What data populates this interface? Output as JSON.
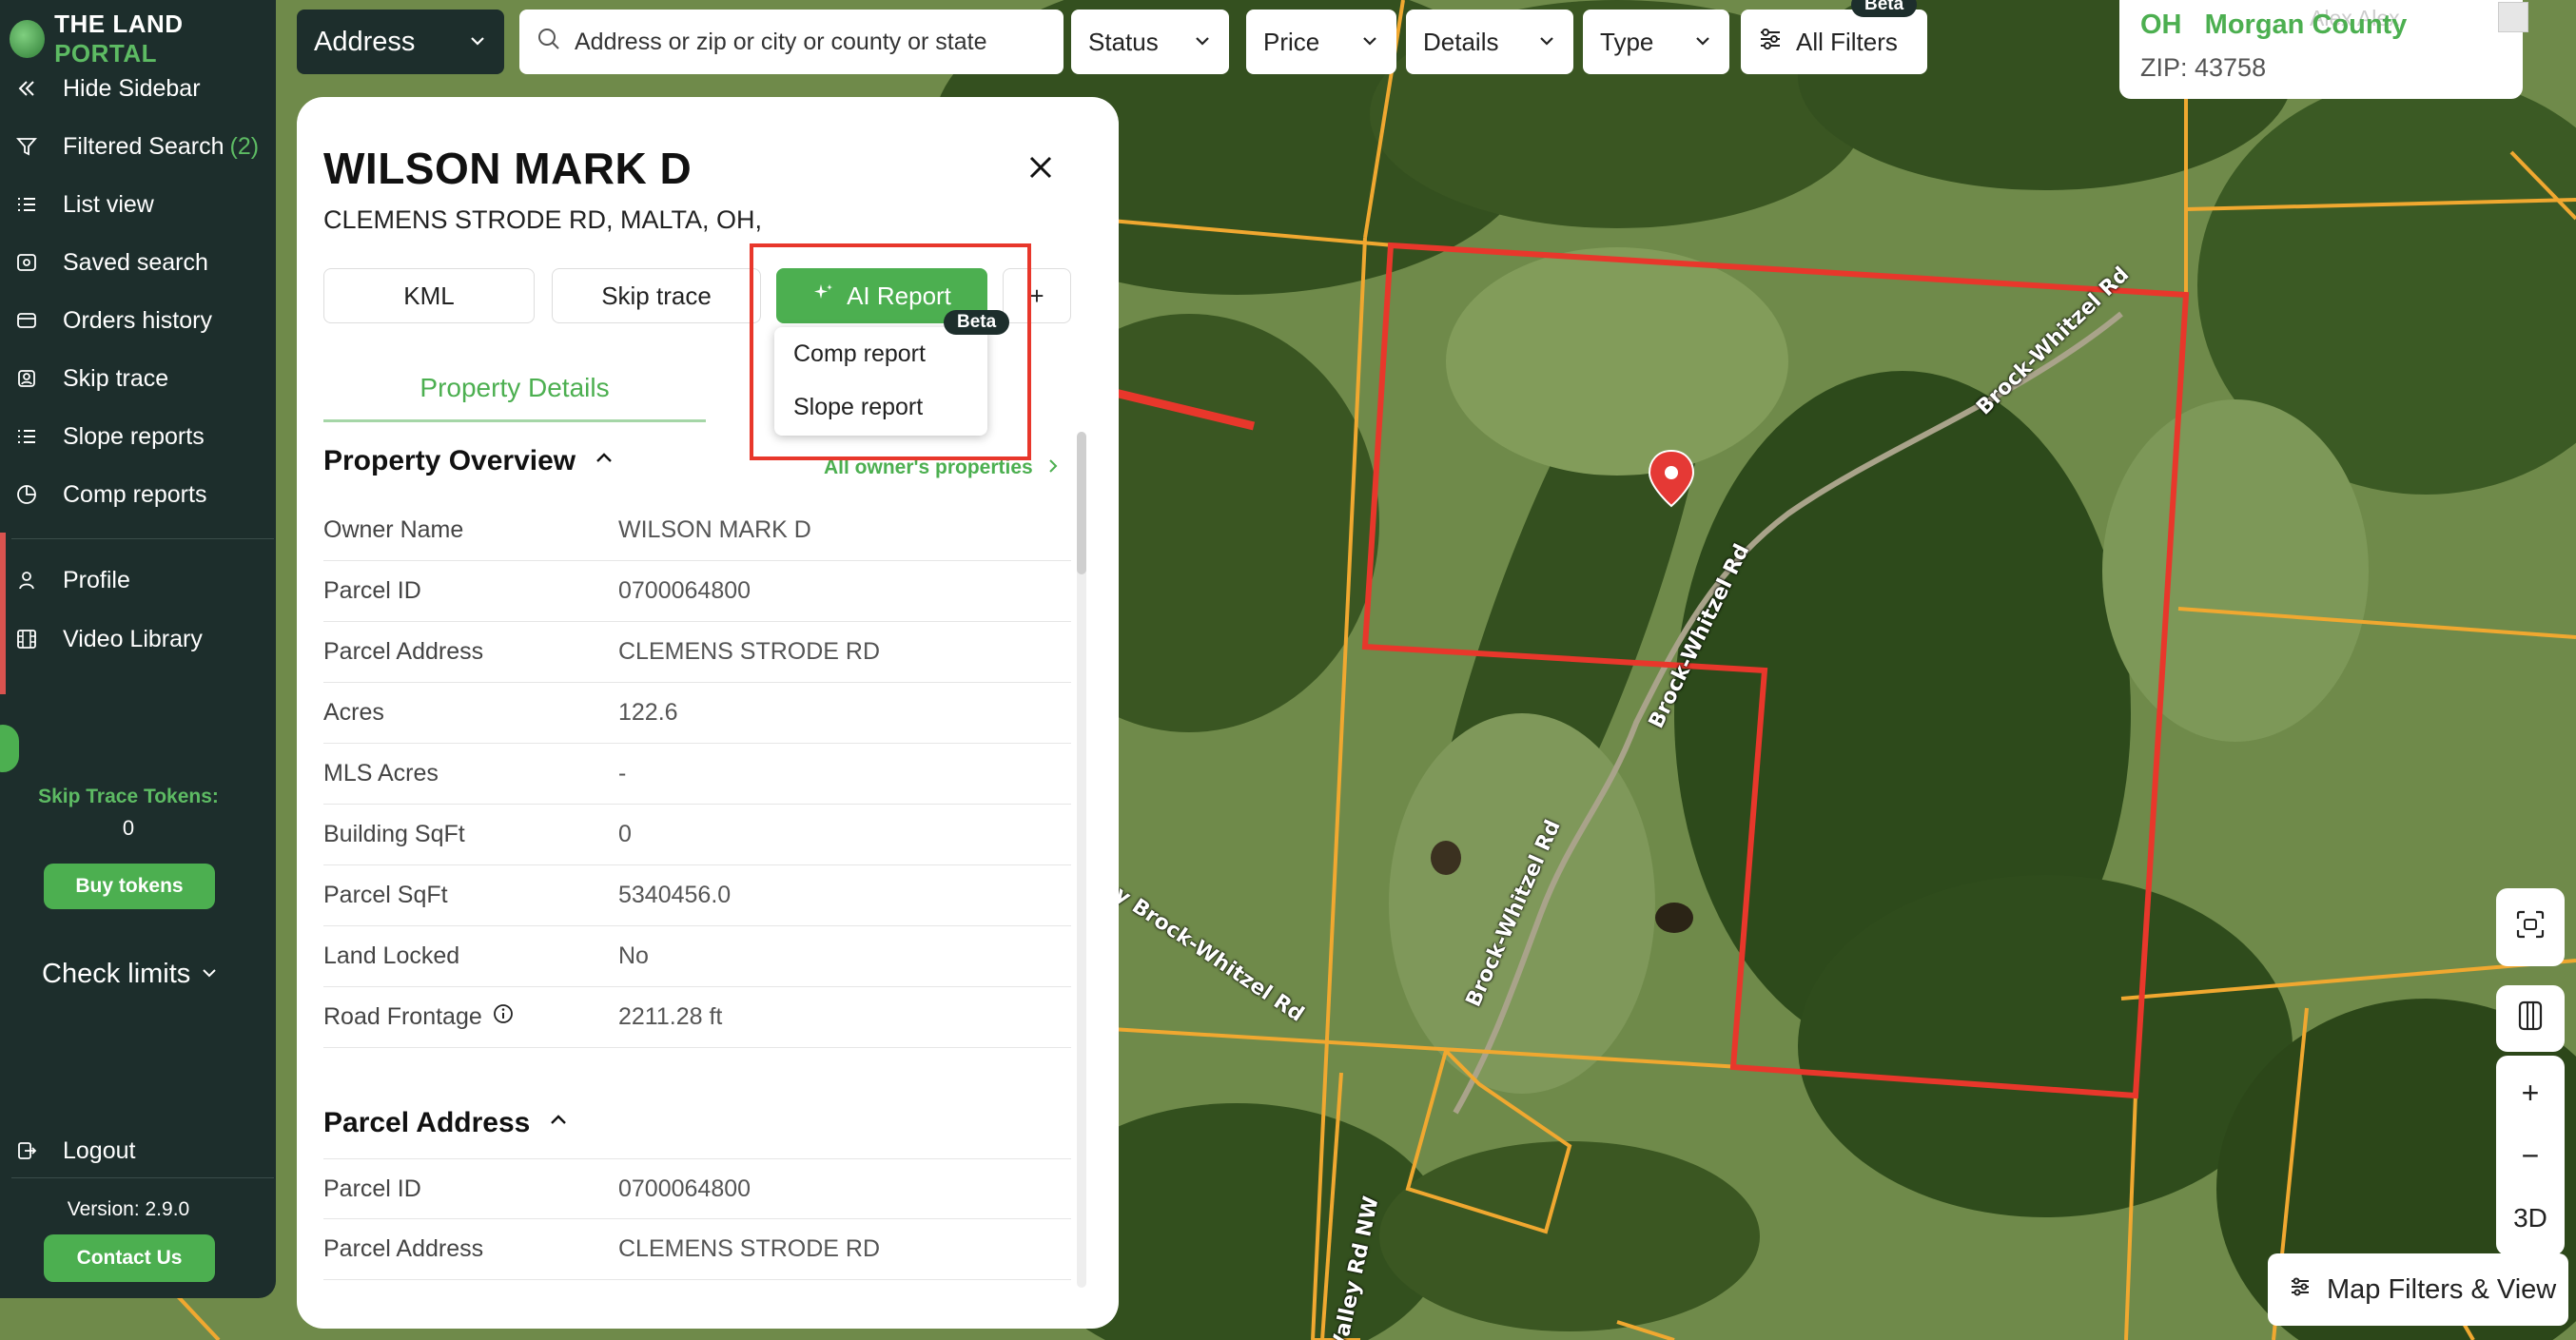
{
  "brand": {
    "name_part1": "THE LAND",
    "name_part2": " PORTAL"
  },
  "sidebar": {
    "items": [
      {
        "label": "Hide Sidebar",
        "icon": "double-chevron-left-icon"
      },
      {
        "label": "Filtered Search",
        "count": "(2)",
        "icon": "funnel-icon"
      },
      {
        "label": "List view",
        "icon": "list-icon"
      },
      {
        "label": "Saved search",
        "icon": "saved-search-icon"
      },
      {
        "label": "Orders history",
        "icon": "orders-icon"
      },
      {
        "label": "Skip trace",
        "icon": "skip-trace-icon"
      },
      {
        "label": "Slope reports",
        "icon": "list-icon"
      },
      {
        "label": "Comp reports",
        "icon": "pie-chart-icon"
      },
      {
        "label": "Profile",
        "icon": "user-icon"
      },
      {
        "label": "Video Library",
        "icon": "film-icon"
      }
    ],
    "tokens_label": "Skip Trace Tokens:",
    "tokens_value": "0",
    "buy_tokens": "Buy tokens",
    "check_limits": "Check limits",
    "logout": "Logout",
    "version": "Version: 2.9.0",
    "contact": "Contact Us"
  },
  "topbar": {
    "address_select": "Address",
    "search_placeholder": "Address or zip or city or county or state",
    "filters": [
      "Status",
      "Price",
      "Details",
      "Type"
    ],
    "all_filters": "All Filters",
    "beta": "Beta"
  },
  "location": {
    "state": "OH",
    "county": "Morgan County",
    "zip": "ZIP: 43758",
    "user": "Alex Alex"
  },
  "panel": {
    "owner": "WILSON MARK D",
    "address": "CLEMENS STRODE RD, MALTA, OH,",
    "buttons": {
      "kml": "KML",
      "skip_trace": "Skip trace",
      "ai_report": "AI Report",
      "more": "+"
    },
    "dropdown": {
      "beta": "Beta",
      "options": [
        "Comp report",
        "Slope report"
      ]
    },
    "tab": "Property Details",
    "overview_title": "Property Overview",
    "owner_link": "All owner's properties",
    "overview_rows": [
      {
        "k": "Owner Name",
        "v": "WILSON MARK D"
      },
      {
        "k": "Parcel ID",
        "v": "0700064800"
      },
      {
        "k": "Parcel Address",
        "v": "CLEMENS STRODE RD"
      },
      {
        "k": "Acres",
        "v": "122.6"
      },
      {
        "k": "MLS Acres",
        "v": "-"
      },
      {
        "k": "Building SqFt",
        "v": "0"
      },
      {
        "k": "Parcel SqFt",
        "v": "5340456.0"
      },
      {
        "k": "Land Locked",
        "v": "No"
      },
      {
        "k": "Road Frontage",
        "v": "2211.28 ft"
      }
    ],
    "parcel_title": "Parcel Address",
    "parcel_rows": [
      {
        "k": "Parcel ID",
        "v": "0700064800"
      },
      {
        "k": "Parcel Address",
        "v": "CLEMENS STRODE RD"
      }
    ]
  },
  "map": {
    "road_labels": [
      "Brock-Whitzel Rd",
      "Brock-Whitzel Rd",
      "Brock-Whitzel Rd",
      "y Brock-Whitzel Rd",
      "Valley Rd NW"
    ],
    "controls": {
      "zoom_in": "+",
      "zoom_out": "−",
      "three_d": "3D"
    },
    "map_filters": "Map Filters & View"
  },
  "colors": {
    "accent": "#4caf50",
    "sidebar": "#1d2e2c",
    "highlight": "#e8372b",
    "parcel_line": "#f0a830"
  }
}
